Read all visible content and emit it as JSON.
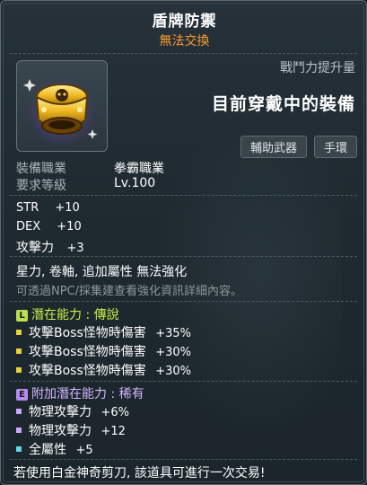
{
  "title": "盾牌防禦",
  "subtitle": "無法交換",
  "combat_power_label": "戰鬥力提升量",
  "equipped_label": "目前穿戴中的裝備",
  "tags": [
    "輔助武器",
    "手環"
  ],
  "requirements": {
    "job_label": "裝備職業",
    "job_value": "拳霸職業",
    "level_label": "要求等級",
    "level_value": "Lv.100"
  },
  "stats": [
    {
      "name": "STR",
      "value": "+10"
    },
    {
      "name": "DEX",
      "value": "+10"
    },
    {
      "name": "攻擊力",
      "value": "+3"
    }
  ],
  "flags_text": "星力, 卷軸, 追加屬性 無法強化",
  "hint_text": "可透過NPC/採集建查看強化資訊詳細內容。",
  "potential": {
    "badge": "L",
    "badge_color": "#b7e04a",
    "title": "潛在能力 : 傳說",
    "title_color": "#c6f04a",
    "bullet_color": "#e8d23a",
    "lines": [
      {
        "name": "攻擊Boss怪物時傷害",
        "value": "+35%"
      },
      {
        "name": "攻擊Boss怪物時傷害",
        "value": "+30%"
      },
      {
        "name": "攻擊Boss怪物時傷害",
        "value": "+30%"
      }
    ]
  },
  "additional_potential": {
    "badge": "E",
    "badge_color": "#b58cf0",
    "title": "附加潛在能力 : 稀有",
    "title_color": "#d4b6ff",
    "lines": [
      {
        "name": "物理攻擊力",
        "value": "+6%",
        "bullet_color": "#c9a6ff"
      },
      {
        "name": "物理攻擊力",
        "value": "+12",
        "bullet_color": "#c9a6ff"
      },
      {
        "name": "全屬性",
        "value": "+5",
        "bullet_color": "#5fd8e8"
      }
    ]
  },
  "footer_text": "若使用白金神奇剪刀, 該道具可進行一次交易!"
}
